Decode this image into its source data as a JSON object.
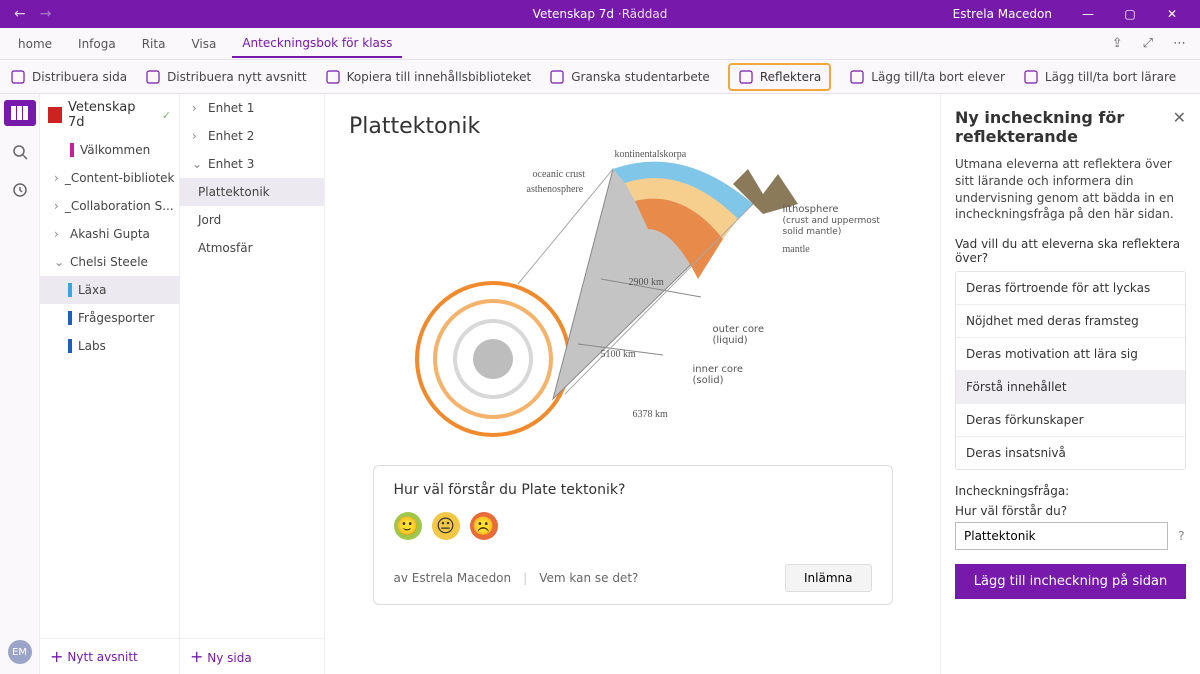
{
  "titlebar": {
    "title_left": "Vetenskap 7d",
    "title_saved": "·Räddad",
    "user": "Estrela Macedon"
  },
  "tabs": {
    "items": [
      "home",
      "Infoga",
      "Rita",
      "Visa",
      "Anteckningsbok för klass"
    ],
    "active_index": 4
  },
  "ribbon": {
    "items": [
      {
        "icon": "distribute-page-icon",
        "label": "Distribuera sida"
      },
      {
        "icon": "distribute-section-icon",
        "label": "Distribuera nytt avsnitt"
      },
      {
        "icon": "copy-library-icon",
        "label": "Kopiera till innehållsbiblioteket"
      },
      {
        "icon": "review-icon",
        "label": "Granska studentarbete"
      },
      {
        "icon": "reflect-icon",
        "label": "Reflektera",
        "highlight": true
      },
      {
        "icon": "add-student-icon",
        "label": "Lägg till/ta bort elever"
      },
      {
        "icon": "add-teacher-icon",
        "label": "Lägg till/ta bort lärare"
      }
    ]
  },
  "rail": {
    "avatar_initials": "EM"
  },
  "notebook": {
    "title": "Vetenskap 7d",
    "sections": [
      {
        "label": "Välkommen",
        "color": "#cc1e9a",
        "chev": ""
      },
      {
        "label": "_Content-bibliotek",
        "chev": "›"
      },
      {
        "label": "_Collaboration S...",
        "chev": "›"
      },
      {
        "label": "Akashi Gupta",
        "chev": "›"
      },
      {
        "label": "Chelsi Steele",
        "chev": "⌄",
        "expanded": true
      },
      {
        "label": "Läxa",
        "color": "#3aa6e0",
        "indent": true,
        "selected": true
      },
      {
        "label": "Frågesporter",
        "color": "#1d5fbf",
        "indent": true
      },
      {
        "label": "Labs",
        "color": "#1d5fbf",
        "indent": true
      }
    ],
    "new_section": "Nytt avsnitt"
  },
  "pages": {
    "units": [
      {
        "label": "Enhet 1",
        "chev": "›"
      },
      {
        "label": "Enhet 2",
        "chev": "›"
      },
      {
        "label": "Enhet 3",
        "chev": "⌄",
        "expanded": true
      }
    ],
    "unit3_pages": [
      {
        "label": "Plattektonik",
        "selected": true
      },
      {
        "label": "Jord"
      },
      {
        "label": "Atmosfär"
      }
    ],
    "new_page": "Ny sida"
  },
  "canvas": {
    "title": "Plattektonik",
    "diagram_labels": {
      "kontinental": "kontinentalskorpa",
      "oceanic": "oceanic crust",
      "asthenosphere": "asthenosphere",
      "lithosphere": "lithosphere",
      "lithosphere_sub": "(crust and uppermost solid mantle)",
      "mantle": "mantle",
      "d2900": "2900 km",
      "outer_core": "outer core",
      "outer_core_sub": "(liquid)",
      "d5100": "5100 km",
      "inner_core": "inner core",
      "inner_core_sub": "(solid)",
      "d6378": "6378 km"
    },
    "reflect_card": {
      "question": "Hur väl förstår du Plate tektonik?",
      "author_prefix": "av ",
      "author": "Estrela Macedon",
      "who_can_see": "Vem kan se det?",
      "submit": "Inlämna"
    }
  },
  "panel": {
    "title": "Ny incheckning för reflekterande",
    "desc": "Utmana eleverna att reflektera över sitt lärande och informera din undervisning genom att bädda in en incheckningsfråga på den här sidan.",
    "question_label": "Vad vill du att eleverna ska reflektera över?",
    "options": [
      "Deras förtroende för att lyckas",
      "Nöjdhet med deras framsteg",
      "Deras motivation att lära sig",
      "Förstå innehållet",
      "Deras förkunskaper",
      "Deras insatsnivå"
    ],
    "selected_option_index": 3,
    "checkin_label": "Incheckningsfråga:",
    "checkin_sub": "Hur väl förstår du?",
    "checkin_value": "Plattektonik",
    "add_button": "Lägg till incheckning på sidan"
  }
}
